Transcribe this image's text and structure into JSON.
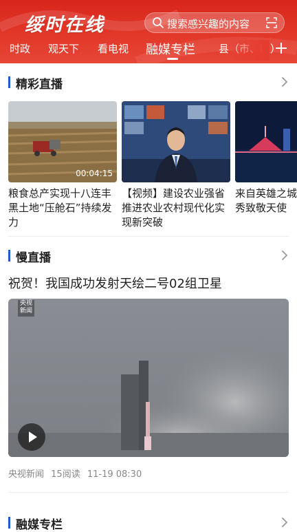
{
  "header": {
    "logo": "绥时在线",
    "search_placeholder": "搜索感兴趣的内容",
    "tabs": [
      {
        "label": "时政"
      },
      {
        "label": "观天下"
      },
      {
        "label": "看电视"
      },
      {
        "label": "融媒专栏",
        "active": true
      },
      {
        "label": "县（市、区）"
      }
    ]
  },
  "sections": {
    "live": {
      "title": "精彩直播",
      "cards": [
        {
          "title": "粮食总产实现十八连丰 黑土地“压舱石”持续发力",
          "duration": "00:04:15"
        },
        {
          "title": "【视频】建设农业强省 推进农业农村现代化实现新突破"
        },
        {
          "title": "来自英雄之城 武汉灯光秀致敬天使"
        }
      ]
    },
    "slow_live": {
      "title": "慢直播",
      "headline": "祝贺！我国成功发射天绘二号02组卫星",
      "badge": "央视新闻",
      "meta": {
        "source": "央视新闻",
        "reads": "15阅读",
        "time": "11-19 08:30"
      }
    },
    "media_column": {
      "title": "融媒专栏"
    }
  },
  "colors": {
    "accent": "#d9261c",
    "section_bar": "#1f5ac8"
  }
}
